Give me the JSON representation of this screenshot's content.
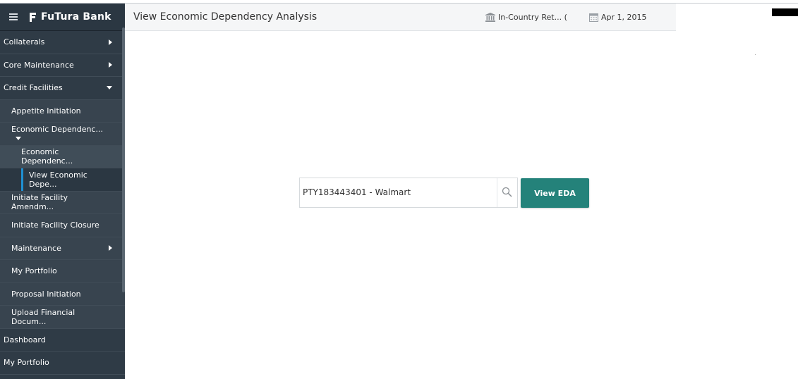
{
  "brand": {
    "name": "FuTura Bank"
  },
  "header": {
    "title": "View Economic Dependency Analysis",
    "branch": "In-Country Ret...  (",
    "date": "Apr 1, 2015"
  },
  "sidebar": {
    "items": [
      {
        "label": "Collaterals"
      },
      {
        "label": "Core Maintenance"
      },
      {
        "label": "Credit Facilities"
      },
      {
        "label": "Appetite Initiation"
      },
      {
        "label": "Economic Dependenc..."
      },
      {
        "label": "Economic Dependenc..."
      },
      {
        "label": "View Economic Depe..."
      },
      {
        "label": "Initiate Facility Amendm..."
      },
      {
        "label": "Initiate Facility Closure"
      },
      {
        "label": "Maintenance"
      },
      {
        "label": "My Portfolio"
      },
      {
        "label": "Proposal Initiation"
      },
      {
        "label": "Upload Financial Docum..."
      },
      {
        "label": "Dashboard"
      },
      {
        "label": "My Portfolio"
      }
    ]
  },
  "search": {
    "value": "PTY183443401 - Walmart"
  },
  "actions": {
    "view_label": "View EDA"
  },
  "colors": {
    "sidebar": "#2f3b46",
    "accent": "#24827a",
    "active_marker": "#1f8fd1"
  }
}
